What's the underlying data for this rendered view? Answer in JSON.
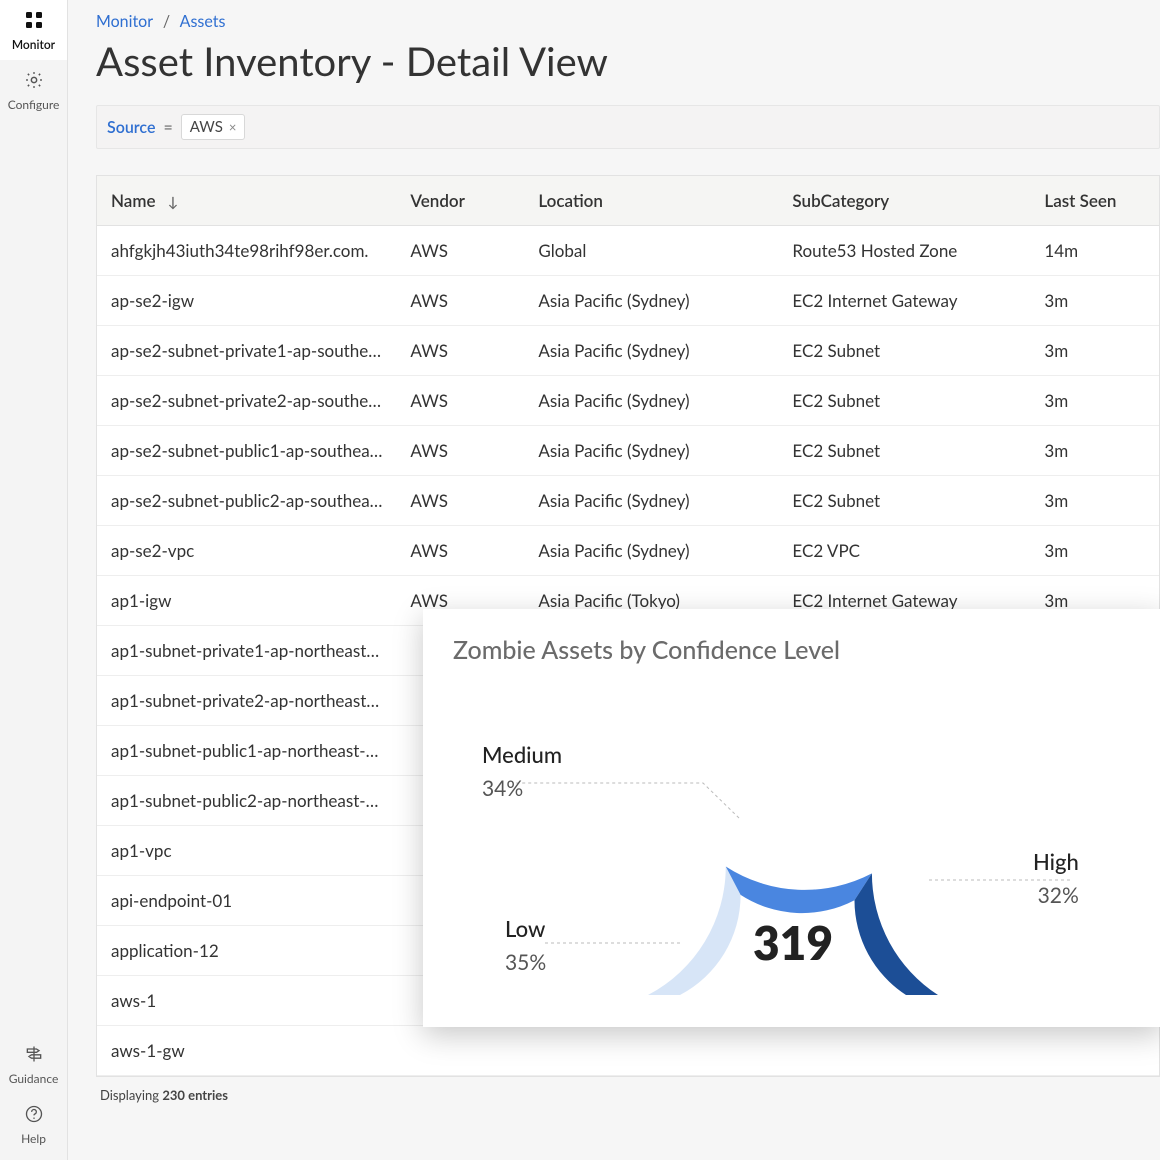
{
  "sidebar": {
    "items": [
      {
        "label": "Monitor",
        "icon": "grid"
      },
      {
        "label": "Configure",
        "icon": "gear"
      }
    ],
    "bottom_items": [
      {
        "label": "Guidance",
        "icon": "sign"
      },
      {
        "label": "Help",
        "icon": "help"
      }
    ]
  },
  "breadcrumb": {
    "parts": [
      "Monitor",
      "Assets"
    ],
    "sep": "/"
  },
  "page_title": "Asset Inventory - Detail View",
  "filter": {
    "key": "Source",
    "eq": "=",
    "chip_value": "AWS",
    "chip_close": "×"
  },
  "table": {
    "columns": [
      "Name",
      "Vendor",
      "Location",
      "SubCategory",
      "Last Seen"
    ],
    "sort_indicator": "↓",
    "rows": [
      {
        "name": "ahfgkjh43iuth34te98rihf98er.com.",
        "vendor": "AWS",
        "location": "Global",
        "subcategory": "Route53 Hosted Zone",
        "last_seen": "14m"
      },
      {
        "name": "ap-se2-igw",
        "vendor": "AWS",
        "location": "Asia Pacific (Sydney)",
        "subcategory": "EC2 Internet Gateway",
        "last_seen": "3m"
      },
      {
        "name": "ap-se2-subnet-private1-ap-southe…",
        "vendor": "AWS",
        "location": "Asia Pacific (Sydney)",
        "subcategory": "EC2 Subnet",
        "last_seen": "3m"
      },
      {
        "name": "ap-se2-subnet-private2-ap-southe…",
        "vendor": "AWS",
        "location": "Asia Pacific (Sydney)",
        "subcategory": "EC2 Subnet",
        "last_seen": "3m"
      },
      {
        "name": "ap-se2-subnet-public1-ap-southea…",
        "vendor": "AWS",
        "location": "Asia Pacific (Sydney)",
        "subcategory": "EC2 Subnet",
        "last_seen": "3m"
      },
      {
        "name": "ap-se2-subnet-public2-ap-southea…",
        "vendor": "AWS",
        "location": "Asia Pacific (Sydney)",
        "subcategory": "EC2 Subnet",
        "last_seen": "3m"
      },
      {
        "name": "ap-se2-vpc",
        "vendor": "AWS",
        "location": "Asia Pacific (Sydney)",
        "subcategory": "EC2 VPC",
        "last_seen": "3m"
      },
      {
        "name": "ap1-igw",
        "vendor": "AWS",
        "location": "Asia Pacific (Tokyo)",
        "subcategory": "EC2 Internet Gateway",
        "last_seen": "3m"
      },
      {
        "name": "ap1-subnet-private1-ap-northeast…",
        "vendor": "",
        "location": "",
        "subcategory": "",
        "last_seen": ""
      },
      {
        "name": "ap1-subnet-private2-ap-northeast…",
        "vendor": "",
        "location": "",
        "subcategory": "",
        "last_seen": ""
      },
      {
        "name": "ap1-subnet-public1-ap-northeast-…",
        "vendor": "",
        "location": "",
        "subcategory": "",
        "last_seen": ""
      },
      {
        "name": "ap1-subnet-public2-ap-northeast-…",
        "vendor": "",
        "location": "",
        "subcategory": "",
        "last_seen": ""
      },
      {
        "name": "ap1-vpc",
        "vendor": "",
        "location": "",
        "subcategory": "",
        "last_seen": ""
      },
      {
        "name": "api-endpoint-01",
        "vendor": "",
        "location": "",
        "subcategory": "",
        "last_seen": ""
      },
      {
        "name": "application-12",
        "vendor": "",
        "location": "",
        "subcategory": "",
        "last_seen": ""
      },
      {
        "name": "aws-1",
        "vendor": "",
        "location": "",
        "subcategory": "",
        "last_seen": ""
      },
      {
        "name": "aws-1-gw",
        "vendor": "",
        "location": "",
        "subcategory": "",
        "last_seen": ""
      }
    ],
    "footer_prefix": "Displaying ",
    "footer_count": "230 entries"
  },
  "chart_card": {
    "title": "Zombie Assets by Confidence Level",
    "total": "319"
  },
  "chart_data": {
    "type": "pie",
    "title": "Zombie Assets by Confidence Level",
    "total": 319,
    "series": [
      {
        "name": "Low",
        "pct": 35,
        "color": "#d7e5f7"
      },
      {
        "name": "Medium",
        "pct": 34,
        "color": "#4a86e0"
      },
      {
        "name": "High",
        "pct": 32,
        "color": "#1c4e96"
      }
    ],
    "labels": {
      "low": {
        "lbl": "Low",
        "val": "35%"
      },
      "medium": {
        "lbl": "Medium",
        "val": "34%"
      },
      "high": {
        "lbl": "High",
        "val": "32%"
      }
    }
  }
}
